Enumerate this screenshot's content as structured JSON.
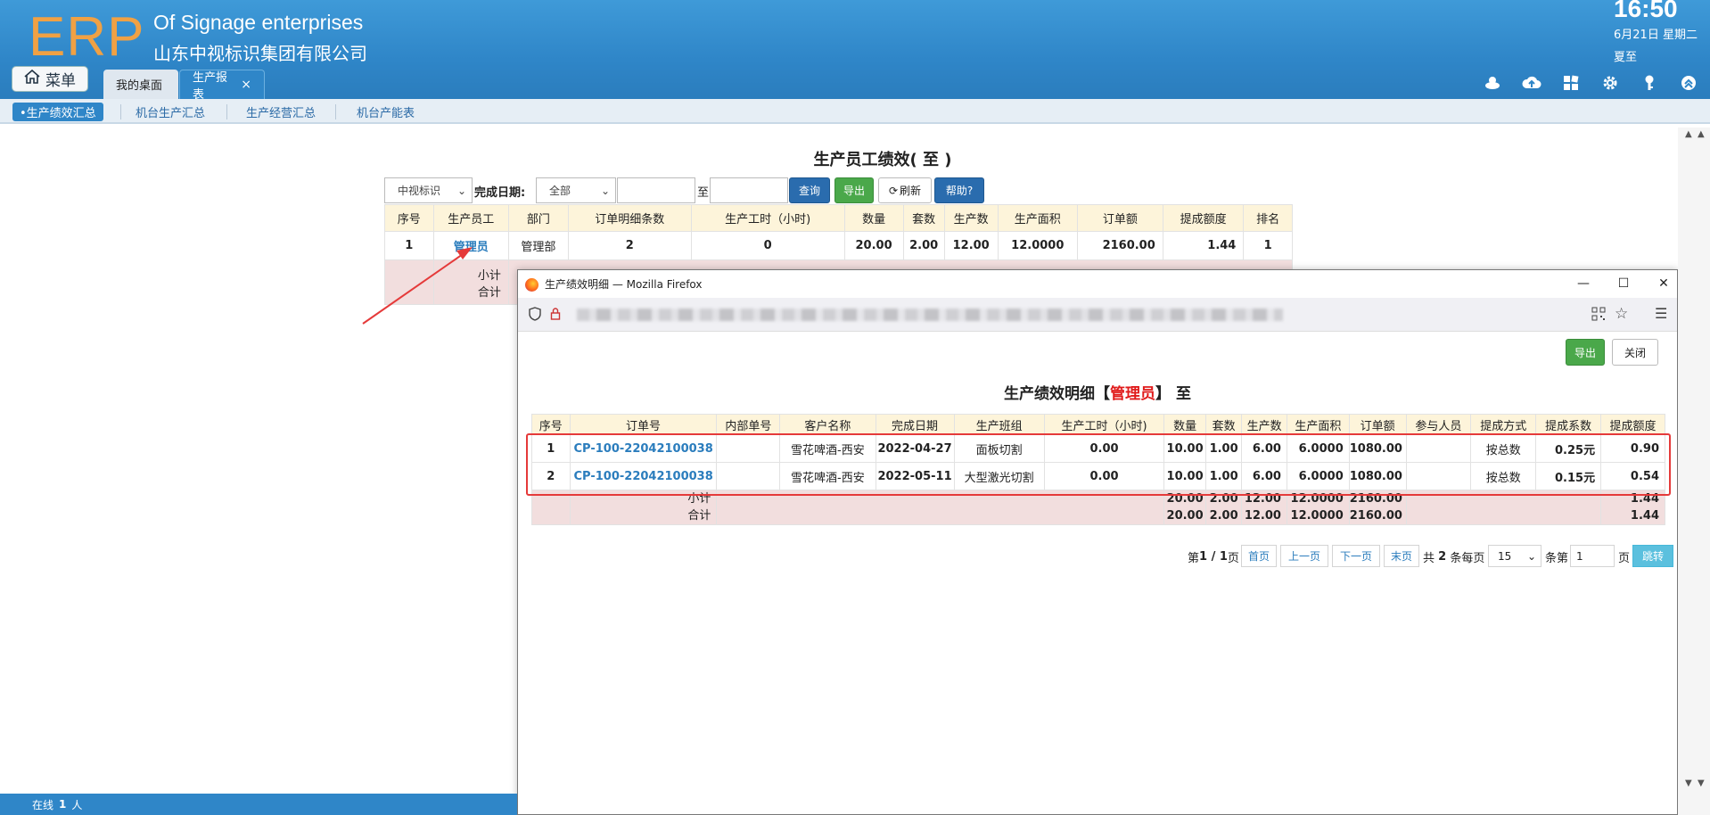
{
  "header": {
    "logo": "ERP",
    "company_en": "Of Signage enterprises",
    "company_cn": "山东中视标识集团有限公司",
    "time": "16:50",
    "date": "6月21日 星期二",
    "solar_term": "夏至",
    "menu_label": "菜单",
    "tabs": [
      {
        "label": "我的桌面"
      },
      {
        "label": "生产报表",
        "close": "×"
      }
    ],
    "icons": [
      "user-icon",
      "cloud-upload-icon",
      "apps-icon",
      "gear-icon",
      "key-icon",
      "logout-icon"
    ]
  },
  "subnav": {
    "items": [
      {
        "label": "•生产绩效汇总",
        "active": true
      },
      {
        "label": "机台生产汇总"
      },
      {
        "label": "生产经营汇总"
      },
      {
        "label": "机台产能表"
      }
    ]
  },
  "report": {
    "title": "生产员工绩效( 至 )",
    "company_select": "中视标识",
    "date_label": "完成日期:",
    "period_select": "全部",
    "to_label": "至",
    "start_value": "",
    "end_value": "",
    "buttons": {
      "query": "查询",
      "export": "导出",
      "refresh": "刷新",
      "help": "帮助?"
    },
    "columns": [
      "序号",
      "生产员工",
      "部门",
      "订单明细条数",
      "生产工时（小时)",
      "数量",
      "套数",
      "生产数",
      "生产面积",
      "订单额",
      "提成额度",
      "排名"
    ],
    "rows": [
      [
        "1",
        "管理员",
        "管理部",
        "2",
        "0",
        "20.00",
        "2.00",
        "12.00",
        "12.0000",
        "2160.00",
        "1.44",
        "1"
      ]
    ],
    "summary": {
      "subtotal": "小计",
      "total": "合计"
    }
  },
  "popup": {
    "window_title": "生产绩效明细 — Mozilla Firefox",
    "buttons": {
      "export": "导出",
      "close": "关闭"
    },
    "title_prefix": "生产绩效明细【",
    "title_user": "管理员",
    "title_suffix": "】 至",
    "columns": [
      "序号",
      "订单号",
      "内部单号",
      "客户名称",
      "完成日期",
      "生产班组",
      "生产工时（小时)",
      "数量",
      "套数",
      "生产数",
      "生产面积",
      "订单额",
      "参与人员",
      "提成方式",
      "提成系数",
      "提成额度"
    ],
    "rows": [
      [
        "1",
        "CP-100-22042100038",
        "",
        "雪花啤酒-西安",
        "2022-04-27",
        "面板切割",
        "0.00",
        "10.00",
        "1.00",
        "6.00",
        "6.0000",
        "1080.00",
        "",
        "按总数",
        "0.25元",
        "0.90"
      ],
      [
        "2",
        "CP-100-22042100038",
        "",
        "雪花啤酒-西安",
        "2022-05-11",
        "大型激光切割",
        "0.00",
        "10.00",
        "1.00",
        "6.00",
        "6.0000",
        "1080.00",
        "",
        "按总数",
        "0.15元",
        "0.54"
      ]
    ],
    "summary": {
      "subtotal": "小计",
      "total": "合计",
      "qty": [
        "20.00",
        "20.00"
      ],
      "sets": [
        "2.00",
        "2.00"
      ],
      "produced": [
        "12.00",
        "12.00"
      ],
      "area": [
        "12.0000",
        "12.0000"
      ],
      "amount": [
        "2160.00",
        "2160.00"
      ],
      "commission": [
        "1.44",
        "1.44"
      ]
    },
    "pager": {
      "page_prefix": "第",
      "page_info": "1 / 1",
      "page_suffix": "页",
      "first": "首页",
      "prev": "上一页",
      "next": "下一页",
      "last": "末页",
      "total_prefix": "共",
      "total": "2",
      "per_page_label": "条每页",
      "per_page": "15",
      "goto_prefix": "条第",
      "goto_value": "1",
      "goto_suffix": "页",
      "jump": "跳转"
    }
  },
  "status": {
    "online_label": "在线",
    "online_count": "1",
    "unit": "人"
  },
  "colors": {
    "header": "#2f86c8",
    "logo": "#f0a144",
    "highlight": "#e53a3a",
    "link": "#2b7dbd"
  }
}
